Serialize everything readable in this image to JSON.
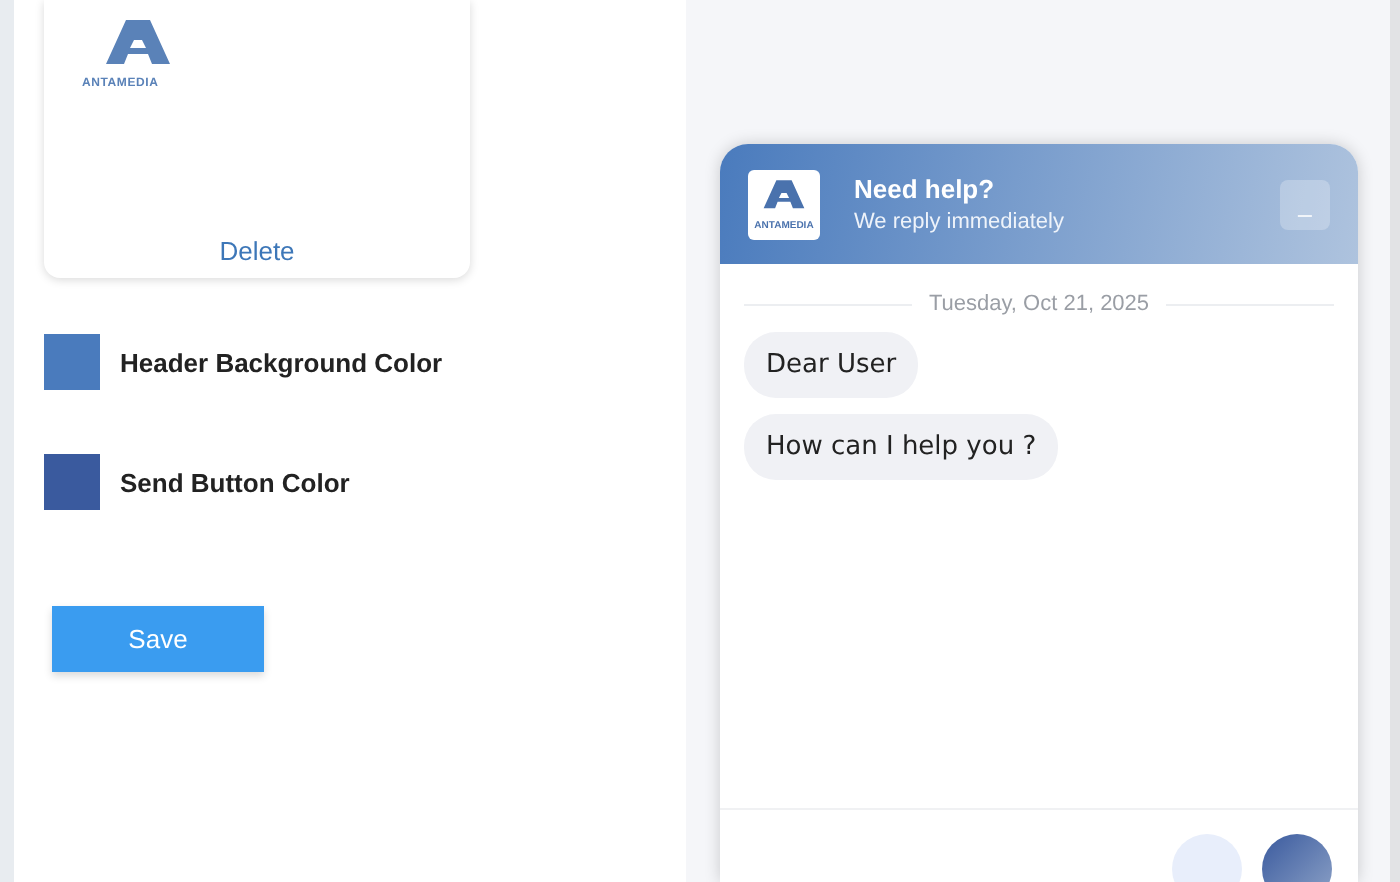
{
  "logo_card": {
    "logo_text": "ANTAMEDIA",
    "delete_link": "Delete"
  },
  "color_settings": [
    {
      "label": "Header Background Color",
      "color": "#4a7bbd"
    },
    {
      "label": "Send Button Color",
      "color": "#3a5a9e"
    }
  ],
  "save_button": "Save",
  "chat": {
    "logo_text": "ANTAMEDIA",
    "title": "Need help?",
    "subtitle": "We reply immediately",
    "minimize": "_",
    "date": "Tuesday, Oct 21, 2025",
    "messages": [
      "Dear User",
      "How can I help you ?"
    ]
  }
}
